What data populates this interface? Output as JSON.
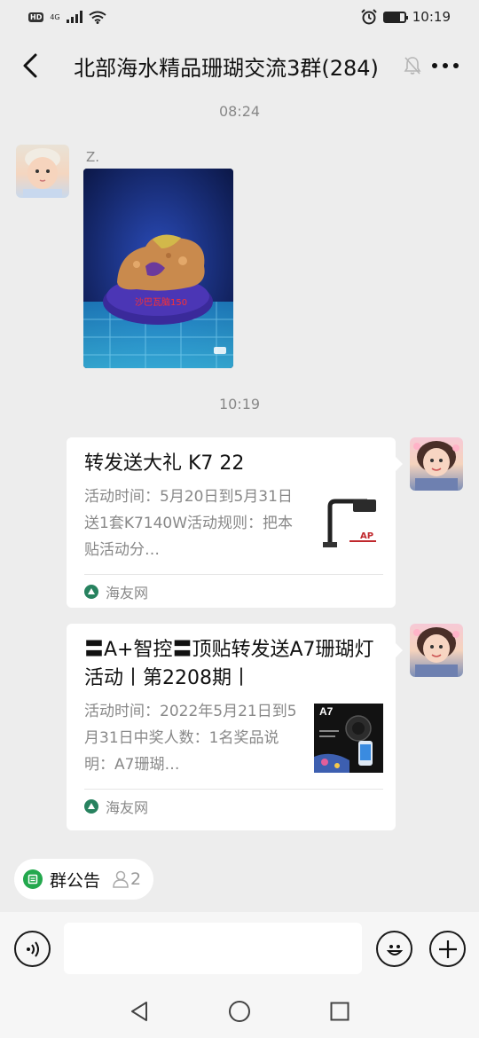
{
  "status_bar": {
    "hd": "HD",
    "network": "4G",
    "time": "10:19",
    "battery_level": 0.8
  },
  "header": {
    "title": "北部海水精品珊瑚交流3群(284)",
    "back_icon": "chevron-left-icon",
    "mute_icon": "bell-off-icon",
    "more_icon": "more-dots-icon"
  },
  "messages": {
    "timestamp1": "08:24",
    "photo": {
      "sender": "Z.",
      "caption": "沙巴瓦脑150"
    },
    "timestamp2": "10:19",
    "link1": {
      "title": "转发送大礼 K7 22",
      "desc": "活动时间：5月20日到5月31日送1套K7140W活动规则：把本贴活动分…",
      "source": "海友网"
    },
    "link2": {
      "title": "〓A+智控〓顶贴转发送A7珊瑚灯活动丨第2208期丨",
      "desc": "活动时间：2022年5月21日到5月31日中奖人数：1名奖品说明：A7珊瑚…",
      "thumb_label": "A7",
      "source": "海友网"
    }
  },
  "notice": {
    "label": "群公告",
    "count": "2"
  },
  "input_bar": {
    "placeholder": "",
    "voice_icon": "voice-icon",
    "emoji_icon": "emoji-icon",
    "add_icon": "plus-icon"
  },
  "nav": {
    "back_icon": "nav-back-icon",
    "home_icon": "nav-home-icon",
    "recent_icon": "nav-recent-icon"
  },
  "colors": {
    "background": "#ededed",
    "accent_green": "#23a84d"
  }
}
